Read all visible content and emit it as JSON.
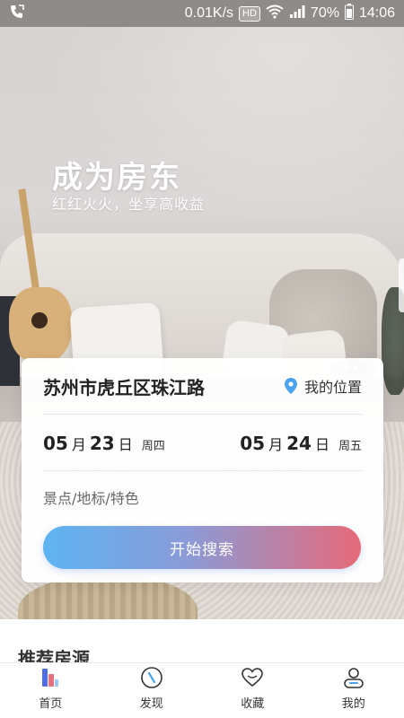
{
  "status_bar": {
    "speed": "0.01K/s",
    "hd": "HD",
    "battery": "70%",
    "time": "14:06"
  },
  "hero": {
    "title": "成为房东",
    "subtitle": "红红火火，坐享高收益"
  },
  "search": {
    "location": "苏州市虎丘区珠江路",
    "my_location": "我的位置",
    "checkin": {
      "month": "05",
      "month_unit": "月",
      "day": "23",
      "day_unit": "日",
      "weekday": "周四"
    },
    "checkout": {
      "month": "05",
      "month_unit": "月",
      "day": "24",
      "day_unit": "日",
      "weekday": "周五"
    },
    "keyword_placeholder": "景点/地标/特色",
    "button": "开始搜索"
  },
  "recommend": {
    "title": "推荐房源"
  },
  "tabbar": {
    "items": [
      {
        "label": "首页",
        "icon": "home-icon"
      },
      {
        "label": "发现",
        "icon": "compass-icon"
      },
      {
        "label": "收藏",
        "icon": "heart-icon"
      },
      {
        "label": "我的",
        "icon": "user-icon"
      }
    ]
  },
  "colors": {
    "accent_start": "#5db4f2",
    "accent_end": "#e66a78",
    "pin": "#4aa3ee"
  }
}
